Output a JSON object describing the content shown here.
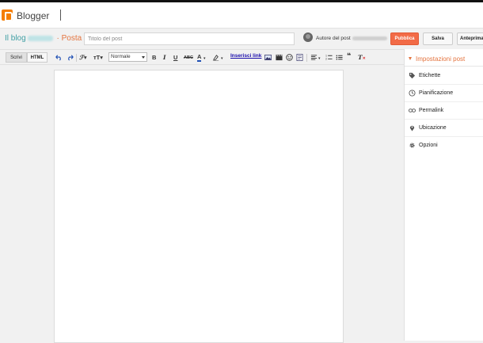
{
  "app": {
    "brand": "Blogger"
  },
  "post_bar": {
    "blog_prefix": "Il blog",
    "separator": "·",
    "section": "Posta",
    "title_placeholder": "Titolo del post",
    "author_label": "Autore del post",
    "publish_label": "Pubblica",
    "save_label": "Salva",
    "preview_label": "Anteprima"
  },
  "toolbar": {
    "write_label": "Scrivi",
    "html_label": "HTML",
    "format_value": "Normale",
    "insert_link_label": "Inserisci link",
    "strike_label": "ABC"
  },
  "sidebar": {
    "header": "Impostazioni post",
    "items": [
      {
        "label": "Etichette",
        "icon": "tag-icon"
      },
      {
        "label": "Pianificazione",
        "icon": "clock-icon"
      },
      {
        "label": "Permalink",
        "icon": "link-icon"
      },
      {
        "label": "Ubicazione",
        "icon": "location-pin-icon"
      },
      {
        "label": "Opzioni",
        "icon": "gear-icon"
      }
    ]
  },
  "colors": {
    "accent": "#e4743f",
    "publish": "#f26b47",
    "blog_link": "#3f9fa4",
    "brand_logo": "#f57d00"
  }
}
